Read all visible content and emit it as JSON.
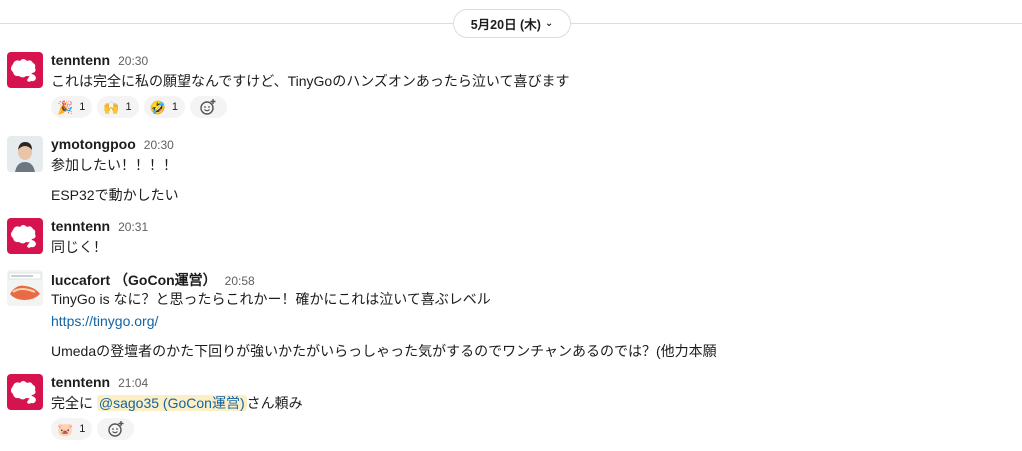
{
  "date_divider": {
    "label": "5月20日 (木)",
    "chevron": "chevron-down-icon"
  },
  "messages": [
    {
      "author": "tenntenn",
      "time": "20:30",
      "text": "これは完全に私の願望なんですけど、TinyGoのハンズオンあったら泣いて喜びます",
      "reactions": [
        {
          "emoji": "🎉",
          "icon": "party-popper-icon",
          "count": "1"
        },
        {
          "emoji": "🙌",
          "icon": "raised-hands-icon",
          "count": "1"
        },
        {
          "emoji": "🤣",
          "icon": "rolling-laughing-icon",
          "count": "1"
        }
      ]
    },
    {
      "author": "ymotongpoo",
      "time": "20:30",
      "text": "参加したい！！！！",
      "text2": "ESP32で動かしたい"
    },
    {
      "author": "tenntenn",
      "time": "20:31",
      "text": "同じく！"
    },
    {
      "author": "luccafort （GoCon運営）",
      "time": "20:58",
      "text": "TinyGo is なに？と思ったらこれかー！確かにこれは泣いて喜ぶレベル",
      "link": "https://tinygo.org/",
      "text2": "Umedaの登壇者のかた下回りが強いかたがいらっしゃった気がするのでワンチャンあるのでは？(他力本願"
    },
    {
      "author": "tenntenn",
      "time": "21:04",
      "text_before": "完全に ",
      "mention": "@sago35 (GoCon運営)",
      "text_after": "さん頼み",
      "reactions": [
        {
          "emoji": "🐷",
          "icon": "pink-creature-icon",
          "count": "1"
        }
      ]
    }
  ],
  "colors": {
    "mention_bg": "#fcefc6",
    "link": "#1264a3",
    "tenntenn_avatar": "#d6124f"
  }
}
